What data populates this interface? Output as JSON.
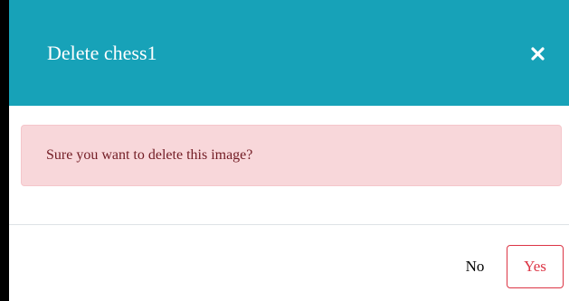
{
  "dialog": {
    "title": "Delete chess1",
    "close_icon": "close-icon",
    "message": "Sure you want to delete this image?",
    "no_label": "No",
    "yes_label": "Yes"
  },
  "colors": {
    "header": "#17a2b8",
    "alert_background": "#f8d7da",
    "alert_text": "#721c24",
    "danger": "#dc3545"
  }
}
